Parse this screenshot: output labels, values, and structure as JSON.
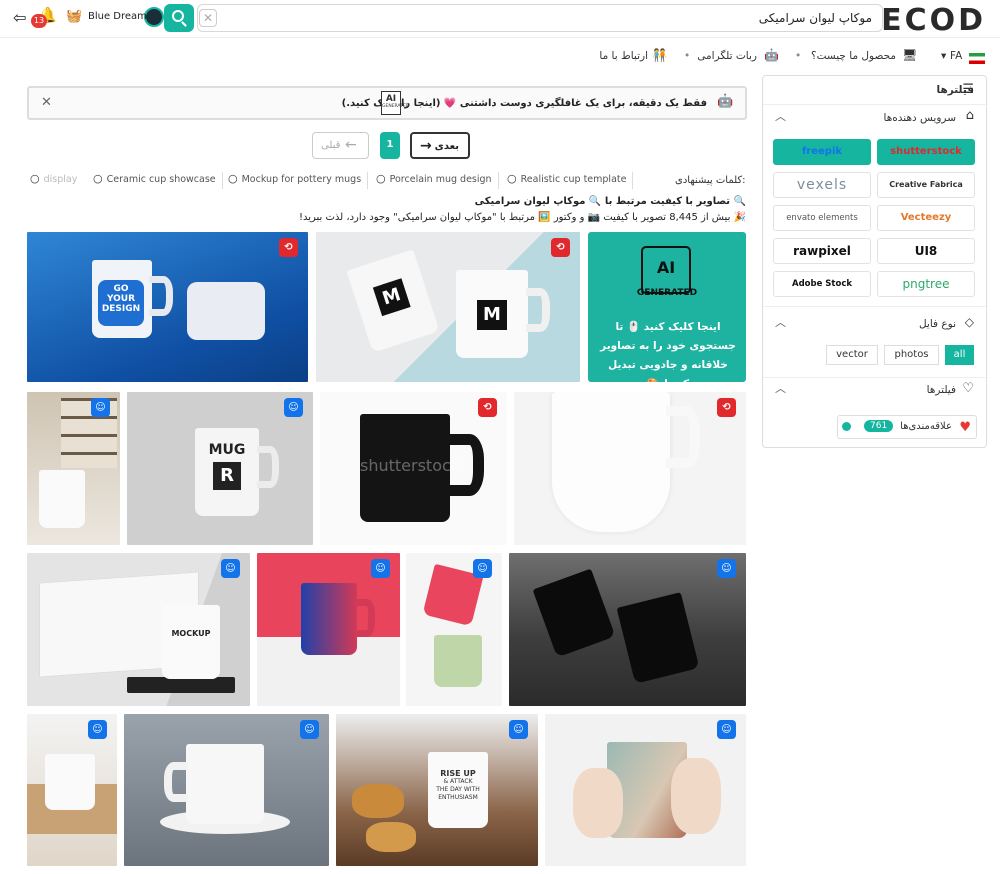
{
  "header": {
    "logo": "DECOD",
    "search_value": "موکاپ لیوان سرامیکی",
    "user_name": "Blue Dream",
    "notification_count": "13"
  },
  "nav": {
    "lang": "FA",
    "what_is_product": "محصول ما چیست؟",
    "telegram_bot": "ربات تلگرامی",
    "contact": "ارتباط با ما"
  },
  "alert": {
    "text": "فقط یک دقیقه، برای یک غافلگیری دوست داشتنی 💗 (اینجا را کلیک کنید.)",
    "ai_badge_line1": "AI",
    "ai_badge_line2": "GENERATED"
  },
  "pagination": {
    "next": "بعدی",
    "prev": "قبلی",
    "page": "1"
  },
  "suggestions": {
    "label": "کلمات پیشنهادی:",
    "items": [
      "Realistic cup template",
      "Porcelain mug design",
      "Mockup for pottery mugs",
      "Ceramic cup showcase",
      "display"
    ]
  },
  "info": {
    "heading": "🔍 تصاویر با کیفیت مرتبط با 🔍 موکاپ لیوان سرامیکی",
    "count_line": "🎉 بیش از 8,445 تصویر با کیفیت 📷 و وکتور 🖼️ مرتبط با \"موکاپ لیوان سرامیکی\" وجود دارد، لذت ببرید!"
  },
  "ai_card": {
    "badge_line1": "AI",
    "badge_line2": "GENERATED",
    "text": "اینجا کلیک کنید 🖱️ تا جستجوی خود را به تصاویر خلاقانه و جادویی تبدیل کنید! 🎨"
  },
  "images": {
    "go_design": [
      "GO",
      "YOUR",
      "DESIGN"
    ],
    "mockup_m": "M",
    "mockup_word": "MOCKUP",
    "mug_word": "MUG",
    "mug_letter": "R",
    "black_mug_watermark": "shutterstock",
    "mockup_cup": "MOCKUP",
    "rise_up": [
      "RISE UP",
      "& ATTACK",
      "THE DAY WITH",
      "ENTHUSIASM"
    ]
  },
  "filters": {
    "title": "فیلترها",
    "providers_title": "سرویس دهنده‌ها",
    "providers": [
      "shutterstock",
      "freepik",
      "Creative Fabrica",
      "vexels",
      "Vecteezy",
      "envato elements",
      "UI8",
      "rawpixel",
      "pngtree",
      "Adobe Stock"
    ],
    "file_type_title": "نوع فایل",
    "file_types": [
      "all",
      "photos",
      "vector"
    ],
    "filters2_title": "فیلترها",
    "favorites_label": "علاقه‌مندی‌ها",
    "favorites_count": "761"
  },
  "colors": {
    "accent": "#16b5a0",
    "shutterstock": "#e1282d",
    "freepik": "#1273eb"
  }
}
